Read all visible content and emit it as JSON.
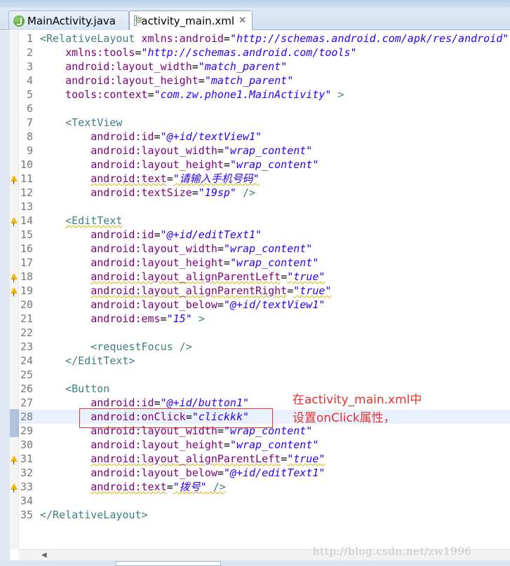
{
  "tabs": [
    {
      "label": "MainActivity.java",
      "icon": "java-file-icon"
    },
    {
      "label": "activity_main.xml",
      "icon": "xml-file-icon",
      "close": "✕"
    }
  ],
  "code_lines": [
    {
      "n": "1",
      "warn": false,
      "segs": [
        [
          "tag",
          "<RelativeLayout "
        ],
        [
          "attr",
          "xmlns:android"
        ],
        [
          "punc",
          "="
        ],
        [
          "val",
          "\"http://schemas.android.com/apk/res/android\""
        ]
      ]
    },
    {
      "n": "2",
      "warn": false,
      "segs": [
        [
          "punc",
          "    "
        ],
        [
          "attr",
          "xmlns:tools"
        ],
        [
          "punc",
          "="
        ],
        [
          "val",
          "\"http://schemas.android.com/tools\""
        ]
      ]
    },
    {
      "n": "3",
      "warn": false,
      "segs": [
        [
          "punc",
          "    "
        ],
        [
          "attr",
          "android:layout_width"
        ],
        [
          "punc",
          "="
        ],
        [
          "val",
          "\"match_parent\""
        ]
      ]
    },
    {
      "n": "4",
      "warn": false,
      "segs": [
        [
          "punc",
          "    "
        ],
        [
          "attr",
          "android:layout_height"
        ],
        [
          "punc",
          "="
        ],
        [
          "val",
          "\"match_parent\""
        ]
      ]
    },
    {
      "n": "5",
      "warn": false,
      "segs": [
        [
          "punc",
          "    "
        ],
        [
          "attr",
          "tools:context"
        ],
        [
          "punc",
          "="
        ],
        [
          "val",
          "\"com.zw.phone1.MainActivity\""
        ],
        [
          "tag",
          " >"
        ]
      ]
    },
    {
      "n": "6",
      "warn": false,
      "segs": []
    },
    {
      "n": "7",
      "warn": false,
      "segs": [
        [
          "punc",
          "    "
        ],
        [
          "tag",
          "<TextView"
        ]
      ]
    },
    {
      "n": "8",
      "warn": false,
      "segs": [
        [
          "punc",
          "        "
        ],
        [
          "attr",
          "android:id"
        ],
        [
          "punc",
          "="
        ],
        [
          "val",
          "\"@+id/textView1\""
        ]
      ]
    },
    {
      "n": "9",
      "warn": false,
      "segs": [
        [
          "punc",
          "        "
        ],
        [
          "attr",
          "android:layout_width"
        ],
        [
          "punc",
          "="
        ],
        [
          "val",
          "\"wrap_content\""
        ]
      ]
    },
    {
      "n": "10",
      "warn": false,
      "segs": [
        [
          "punc",
          "        "
        ],
        [
          "attr",
          "android:layout_height"
        ],
        [
          "punc",
          "="
        ],
        [
          "val",
          "\"wrap_content\""
        ]
      ]
    },
    {
      "n": "11",
      "warn": true,
      "segs": [
        [
          "punc",
          "        "
        ],
        [
          "attr",
          "android:text"
        ],
        [
          "punc",
          "="
        ],
        [
          "val",
          "\"请输入手机号码\""
        ]
      ]
    },
    {
      "n": "12",
      "warn": false,
      "segs": [
        [
          "punc",
          "        "
        ],
        [
          "attr",
          "android:textSize"
        ],
        [
          "punc",
          "="
        ],
        [
          "val",
          "\"19sp\""
        ],
        [
          "tag",
          " />"
        ]
      ]
    },
    {
      "n": "13",
      "warn": false,
      "segs": []
    },
    {
      "n": "14",
      "warn": true,
      "segs": [
        [
          "punc",
          "    "
        ],
        [
          "tag",
          "<EditText"
        ]
      ]
    },
    {
      "n": "15",
      "warn": false,
      "segs": [
        [
          "punc",
          "        "
        ],
        [
          "attr",
          "android:id"
        ],
        [
          "punc",
          "="
        ],
        [
          "val",
          "\"@+id/editText1\""
        ]
      ]
    },
    {
      "n": "16",
      "warn": false,
      "segs": [
        [
          "punc",
          "        "
        ],
        [
          "attr",
          "android:layout_width"
        ],
        [
          "punc",
          "="
        ],
        [
          "val",
          "\"wrap_content\""
        ]
      ]
    },
    {
      "n": "17",
      "warn": false,
      "segs": [
        [
          "punc",
          "        "
        ],
        [
          "attr",
          "android:layout_height"
        ],
        [
          "punc",
          "="
        ],
        [
          "val",
          "\"wrap_content\""
        ]
      ]
    },
    {
      "n": "18",
      "warn": true,
      "segs": [
        [
          "punc",
          "        "
        ],
        [
          "attr",
          "android:layout_alignParentLeft"
        ],
        [
          "punc",
          "="
        ],
        [
          "val",
          "\"true\""
        ]
      ]
    },
    {
      "n": "19",
      "warn": true,
      "segs": [
        [
          "punc",
          "        "
        ],
        [
          "attr",
          "android:layout_alignParentRight"
        ],
        [
          "punc",
          "="
        ],
        [
          "val",
          "\"true\""
        ]
      ]
    },
    {
      "n": "20",
      "warn": false,
      "segs": [
        [
          "punc",
          "        "
        ],
        [
          "attr",
          "android:layout_below"
        ],
        [
          "punc",
          "="
        ],
        [
          "val",
          "\"@+id/textView1\""
        ]
      ]
    },
    {
      "n": "21",
      "warn": false,
      "segs": [
        [
          "punc",
          "        "
        ],
        [
          "attr",
          "android:ems"
        ],
        [
          "punc",
          "="
        ],
        [
          "val",
          "\"15\""
        ],
        [
          "tag",
          " >"
        ]
      ]
    },
    {
      "n": "22",
      "warn": false,
      "segs": []
    },
    {
      "n": "23",
      "warn": false,
      "segs": [
        [
          "punc",
          "        "
        ],
        [
          "tag",
          "<requestFocus />"
        ]
      ]
    },
    {
      "n": "24",
      "warn": false,
      "segs": [
        [
          "punc",
          "    "
        ],
        [
          "tag",
          "</EditText>"
        ]
      ]
    },
    {
      "n": "25",
      "warn": false,
      "segs": []
    },
    {
      "n": "26",
      "warn": false,
      "segs": [
        [
          "punc",
          "    "
        ],
        [
          "tag",
          "<Button"
        ]
      ]
    },
    {
      "n": "27",
      "warn": false,
      "segs": [
        [
          "punc",
          "        "
        ],
        [
          "attr",
          "android:id"
        ],
        [
          "punc",
          "="
        ],
        [
          "val",
          "\"@+id/button1\""
        ]
      ]
    },
    {
      "n": "28",
      "warn": false,
      "current": true,
      "segs": [
        [
          "punc",
          "        "
        ],
        [
          "attr",
          "android:onClick"
        ],
        [
          "punc",
          "="
        ],
        [
          "val",
          "\"clickkk\""
        ]
      ]
    },
    {
      "n": "29",
      "warn": false,
      "segs": [
        [
          "punc",
          "        "
        ],
        [
          "attr",
          "android:layout_width"
        ],
        [
          "punc",
          "="
        ],
        [
          "val",
          "\"wrap_content\""
        ]
      ]
    },
    {
      "n": "30",
      "warn": false,
      "segs": [
        [
          "punc",
          "        "
        ],
        [
          "attr",
          "android:layout_height"
        ],
        [
          "punc",
          "="
        ],
        [
          "val",
          "\"wrap_content\""
        ]
      ]
    },
    {
      "n": "31",
      "warn": true,
      "segs": [
        [
          "punc",
          "        "
        ],
        [
          "attr",
          "android:layout_alignParentLeft"
        ],
        [
          "punc",
          "="
        ],
        [
          "val",
          "\"true\""
        ]
      ]
    },
    {
      "n": "32",
      "warn": false,
      "segs": [
        [
          "punc",
          "        "
        ],
        [
          "attr",
          "android:layout_below"
        ],
        [
          "punc",
          "="
        ],
        [
          "val",
          "\"@+id/editText1\""
        ]
      ]
    },
    {
      "n": "33",
      "warn": true,
      "segs": [
        [
          "punc",
          "        "
        ],
        [
          "attr",
          "android:text"
        ],
        [
          "punc",
          "="
        ],
        [
          "val",
          "\"拨号\""
        ],
        [
          "tag",
          " />"
        ]
      ]
    },
    {
      "n": "34",
      "warn": false,
      "segs": []
    },
    {
      "n": "35",
      "warn": false,
      "segs": [
        [
          "tag",
          "</RelativeLayout>"
        ]
      ]
    }
  ],
  "annotation": {
    "line1": "在activity_main.xml中",
    "line2": "设置onClick属性，"
  },
  "watermark": "http://blog.csdn.net/zw1996",
  "colors": {
    "tag": "#3f7f7f",
    "attribute": "#7f007f",
    "value": "#2a00ff",
    "annotation": "#e5322d",
    "current_line": "#e8f2fe"
  }
}
